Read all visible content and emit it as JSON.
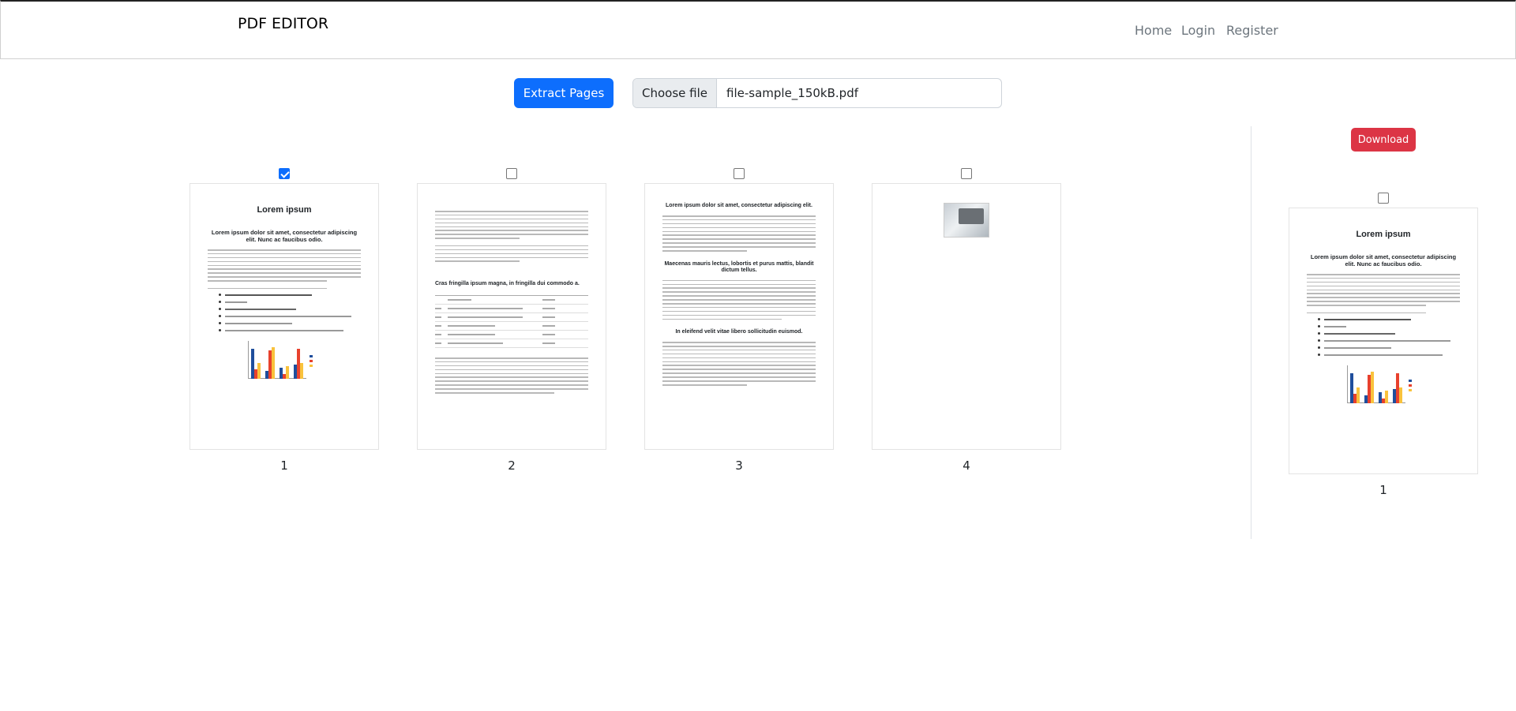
{
  "navbar": {
    "brand": "PDF EDITOR",
    "links": [
      "Home",
      "Login",
      "Register"
    ]
  },
  "toolbar": {
    "extract_label": "Extract Pages",
    "choose_file_label": "Choose file",
    "file_name": "file-sample_150kB.pdf"
  },
  "download_label": "Download",
  "pages": [
    {
      "number": "1",
      "checked": true,
      "heading": "Lorem ipsum",
      "subheading": "Lorem ipsum dolor sit amet, consectetur adipiscing elit. Nunc ac faucibus odio."
    },
    {
      "number": "2",
      "checked": false,
      "heading": "Cras fringilla ipsum magna, in fringilla dui commodo a."
    },
    {
      "number": "3",
      "checked": false,
      "heading": "Lorem ipsum dolor sit amet, consectetur adipiscing elit.",
      "subheading": "Maecenas mauris lectus, lobortis et purus mattis, blandit dictum tellus.",
      "subheading2": "In eleifend velit vitae libero sollicitudin euismod."
    },
    {
      "number": "4",
      "checked": false
    }
  ],
  "selected": [
    {
      "number": "1",
      "checked": false,
      "heading": "Lorem ipsum",
      "subheading": "Lorem ipsum dolor sit amet, consectetur adipiscing elit. Nunc ac faucibus odio."
    }
  ],
  "colors": {
    "primary": "#0d6efd",
    "danger": "#dc3545",
    "chart_series": [
      "#1f4e9c",
      "#e8412d",
      "#f9c23c"
    ]
  }
}
